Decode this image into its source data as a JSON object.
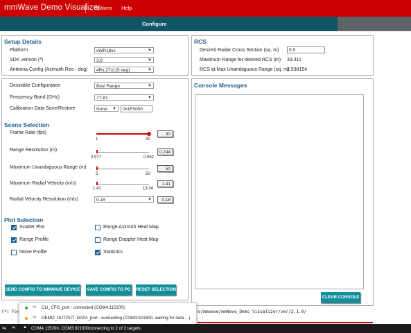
{
  "app": {
    "title": "mmWave Demo Visualizer"
  },
  "menu": {
    "options": "Options",
    "help": "Help"
  },
  "tabs": {
    "configure": "Configure"
  },
  "setup": {
    "title": "Setup Details",
    "platform_label": "Platform",
    "platform_value": "xWR18xx",
    "sdk_label": "SDK version (*)",
    "sdk_value": "3.6",
    "antenna_label": "Antenna Config (Azimuth Res - deg)",
    "antenna_value": "4Rx,2Tx(15 deg)"
  },
  "rcs": {
    "title": "RCS",
    "desired_label": "Desired Radar Cross Section (sq. m)",
    "desired_value": "0.5",
    "max_range_label": "Maximum Range for desired RCS (m)",
    "max_range_value": "33.311",
    "rcs_max_label": "RCS at Max Unambiguous Range (sq. m)",
    "rcs_max_value": "2.538154"
  },
  "config": {
    "desirable_label": "Desirable Configuration",
    "desirable_value": "Best Range",
    "freq_label": "Frequency Band (GHz)",
    "freq_value": "77-81",
    "calib_label": "Calibration Data Save/Restore",
    "calib_value": "None",
    "calib_addr": "0x1F0000"
  },
  "scene": {
    "title": "Scene Selection",
    "frame_rate": {
      "label": "Frame Rate (fps)",
      "min": "1",
      "max": "30",
      "value": "30",
      "level": 1.0
    },
    "range_res": {
      "label": "Range Resolution (m)",
      "min": "0.977",
      "max": "0.062",
      "value": "0.244"
    },
    "max_unamb": {
      "label": "Maximum Unambiguous Range (m)",
      "min": "5",
      "max": "50",
      "value": "50"
    },
    "max_vel": {
      "label": "Maximum Radial Velocity (m/s)",
      "min": "1.41",
      "max": "13.34",
      "value": "1.41"
    },
    "vel_res": {
      "label": "Radial Velocity Resolution (m/s)",
      "select": "0.18",
      "value": "0.18"
    }
  },
  "plot": {
    "title": "Plot Selection",
    "scatter": {
      "label": "Scatter Plot",
      "checked": true
    },
    "range_profile": {
      "label": "Range Profile",
      "checked": true
    },
    "noise_profile": {
      "label": "Noise Profile",
      "checked": false
    },
    "azimuth_heat": {
      "label": "Range Azimuth Heat Map",
      "checked": false
    },
    "doppler_heat": {
      "label": "Range Doppler Heat Map",
      "checked": false
    },
    "statistics": {
      "label": "Statistics",
      "checked": true
    }
  },
  "buttons": {
    "send_config": "SEND CONFIG TO MMWAVE DEVICE",
    "save_config": "SAVE CONFIG TO PC",
    "reset": "RESET SELECTION",
    "clear_console": "CLEAR CONSOLE"
  },
  "console": {
    "title": "Console Messages"
  },
  "cmdline": {
    "left": "(*) For",
    "right": "ev/mmwave/mmWave_Demo_Visualizer/ver/2.1.0/"
  },
  "popup": {
    "cli_port": "CLI_CFG_port - connected (COM4:115200)",
    "data_port": "DEMO_OUTPUT_DATA_port - connecting (COM3:921600, waiting for data ...)"
  },
  "status": {
    "ports": "COM4:115200, COM3:921600",
    "message": "connecting to 2 of 2 targets."
  },
  "colors": {
    "brand": "#cc0000",
    "tab": "#115566",
    "button": "#138f9b",
    "title": "#1f5f8b"
  }
}
